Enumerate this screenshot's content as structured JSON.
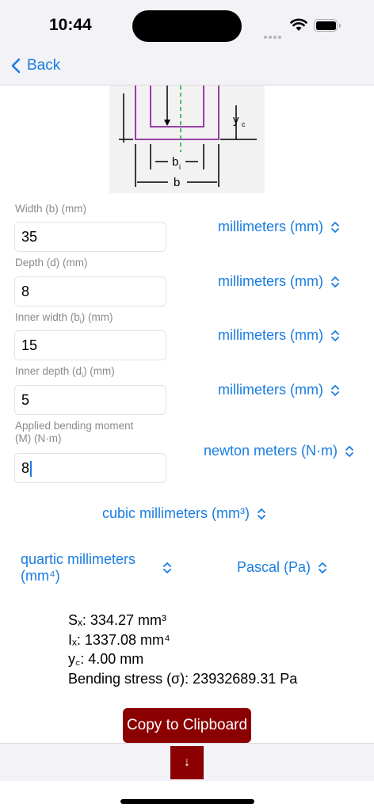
{
  "status": {
    "time": "10:44"
  },
  "nav": {
    "back_label": "Back"
  },
  "diagram": {
    "yc_label": "y",
    "yc_sub": "c",
    "bi_label": "b",
    "bi_sub": "i",
    "b_label": "b"
  },
  "fields": [
    {
      "label": "Width (b) (mm)",
      "value": "35",
      "unit": "millimeters (mm)"
    },
    {
      "label": "Depth (d) (mm)",
      "value": "8",
      "unit": "millimeters (mm)"
    },
    {
      "label_pre": "Inner width (b",
      "label_sub": "i",
      "label_post": ") (mm)",
      "value": "15",
      "unit": "millimeters (mm)"
    },
    {
      "label_pre": "Inner depth (d",
      "label_sub": "i",
      "label_post": ") (mm)",
      "value": "5",
      "unit": "millimeters (mm)"
    },
    {
      "label_line1": "Applied bending moment",
      "label_line2": "(M) (N·m)",
      "value": "8",
      "unit": "newton meters (N·m)"
    }
  ],
  "unit_selectors": {
    "section_modulus": "cubic millimeters (mm³)",
    "moment_of_inertia_line1": "quartic millimeters",
    "moment_of_inertia_line2": "(mm⁴)",
    "stress": "Pascal (Pa)"
  },
  "results": {
    "sx": "Sₓ: 334.27 mm³",
    "ix": "Iₓ: 1337.08 mm⁴",
    "yc": "y꜀: 4.00  mm",
    "stress": "Bending stress (σ): 23932689.31  Pa"
  },
  "copy_button": "Copy to Clipboard",
  "down_button": "↓",
  "colors": {
    "accent": "#1a7de0",
    "button": "#8b0000",
    "bar_bg": "#f2f2f7"
  }
}
